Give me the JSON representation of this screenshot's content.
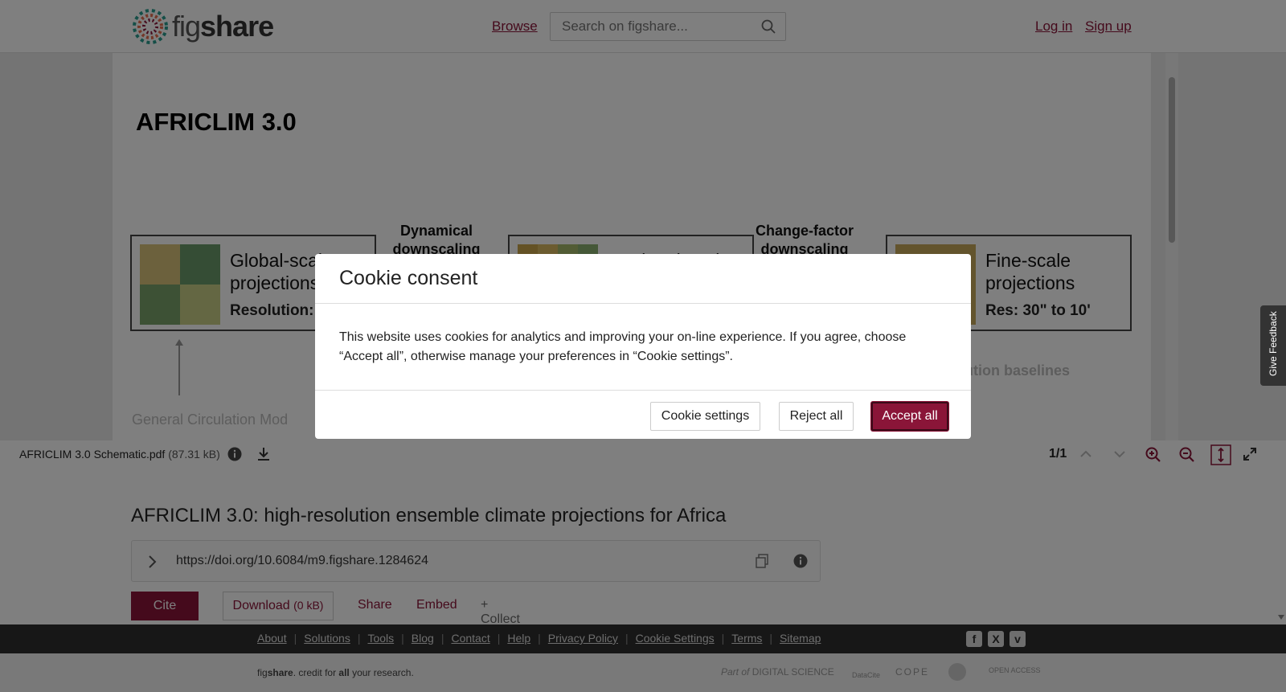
{
  "header": {
    "logo_text_light": "fig",
    "logo_text_bold": "share",
    "browse": "Browse",
    "search_placeholder": "Search on figshare...",
    "login": "Log in",
    "signup": "Sign up"
  },
  "viewer": {
    "pdf_title": "AFRICLIM 3.0",
    "box_global": {
      "title": "Global-scale projections",
      "res": "Resolution:"
    },
    "box_regional": {
      "title": "Regional-scale"
    },
    "box_fine": {
      "title": "Fine-scale projections",
      "res": "Res: 30\" to 10'"
    },
    "label_dynamical": "Dynamical downscaling",
    "label_change_factor": "Change-factor downscaling",
    "faint_baselines": "ution baselines",
    "faint_models": "General Circulation Mod"
  },
  "filebar": {
    "filename": "AFRICLIM 3.0 Schematic.pdf",
    "size": "(87.31 kB)",
    "page_count": "1/1"
  },
  "item": {
    "title": "AFRICLIM 3.0: high-resolution ensemble climate projections for Africa",
    "doi": "https://doi.org/10.6084/m9.figshare.1284624",
    "cite": "Cite",
    "download": "Download",
    "download_size": "(0 kB)",
    "share": "Share",
    "embed": "Embed",
    "collect": "+ Collect"
  },
  "footer": {
    "links": [
      "About",
      "Solutions",
      "Tools",
      "Blog",
      "Contact",
      "Help",
      "Privacy Policy",
      "Cookie Settings",
      "Terms",
      "Sitemap"
    ],
    "tagline_fig": "fig",
    "tagline_share": "share",
    "tagline_mid": ". credit for ",
    "tagline_all": "all",
    "tagline_end": " your research.",
    "partner_ds_prefix": "Part of",
    "partner_ds": "DIGITAL SCIENCE",
    "partner_datacite": "DataCite",
    "partner_cope": "COPE",
    "partner_oa": "OPEN ACCESS"
  },
  "modal": {
    "title": "Cookie consent",
    "body": "This website uses cookies for analytics and improving your on-line experience. If you agree, choose “Accept all”, otherwise manage your preferences in “Cookie settings”.",
    "settings": "Cookie settings",
    "reject": "Reject all",
    "accept": "Accept all"
  },
  "feedback": "Give Feedback",
  "colors": {
    "brand": "#8a1538",
    "footer_dark": "#2e2e2e"
  }
}
